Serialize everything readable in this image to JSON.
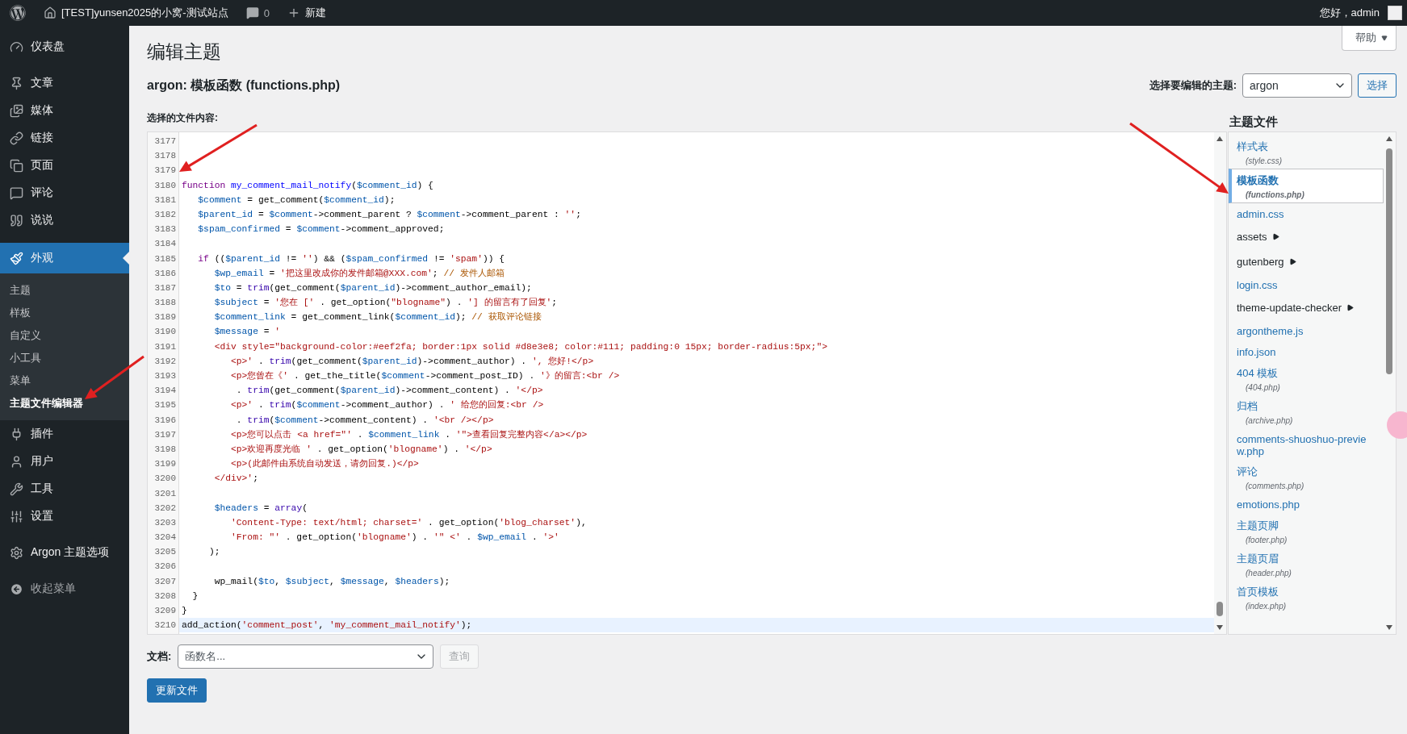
{
  "admin_bar": {
    "site_title": "[TEST]yunsen2025的小窝-测试站点",
    "comments": "0",
    "new": "新建",
    "greeting": "您好，admin"
  },
  "menu_groups": [
    [
      {
        "label": "仪表盘",
        "selected": false
      }
    ],
    [
      {
        "label": "文章",
        "selected": false
      },
      {
        "label": "媒体",
        "selected": false
      },
      {
        "label": "链接",
        "selected": false
      },
      {
        "label": "页面",
        "selected": false
      },
      {
        "label": "评论",
        "selected": false
      },
      {
        "label": "说说",
        "selected": false
      }
    ],
    [
      {
        "label": "外观",
        "selected": true,
        "submenu": [
          {
            "label": "主题",
            "selected": false
          },
          {
            "label": "样板",
            "selected": false
          },
          {
            "label": "自定义",
            "selected": false
          },
          {
            "label": "小工具",
            "selected": false
          },
          {
            "label": "菜单",
            "selected": false
          },
          {
            "label": "主题文件编辑器",
            "selected": true
          }
        ]
      },
      {
        "label": "插件",
        "selected": false
      },
      {
        "label": "用户",
        "selected": false
      },
      {
        "label": "工具",
        "selected": false
      },
      {
        "label": "设置",
        "selected": false
      }
    ],
    [
      {
        "label": "Argon 主题选项",
        "selected": false
      }
    ]
  ],
  "collapse_menu": "收起菜单",
  "help": "帮助",
  "title": "编辑主题",
  "file_heading": "argon: 模板函数 (functions.php)",
  "theme_picker": {
    "label": "选择要编辑的主题:",
    "value": "argon",
    "button": "选择"
  },
  "content_label": "选择的文件内容:",
  "code_lines": [
    {
      "number": "3177",
      "active": false
    },
    {
      "number": "3178",
      "active": false
    },
    {
      "number": "3179",
      "active": false
    },
    {
      "number": "3180",
      "active": false,
      "tokens": [
        {
          "kind": "keyword",
          "text": "function"
        },
        {
          "kind": "def",
          "text": " my_comment_mail_notify"
        },
        {
          "kind": "plain",
          "text": "("
        },
        {
          "kind": "var",
          "text": "$comment_id"
        },
        {
          "kind": "plain",
          "text": ") {"
        }
      ]
    },
    {
      "number": "3181",
      "active": false,
      "tokens": [
        {
          "kind": "var",
          "text": "   $comment"
        },
        {
          "kind": "plain",
          "text": " = get_comment("
        },
        {
          "kind": "var",
          "text": "$comment_id"
        },
        {
          "kind": "plain",
          "text": ");"
        }
      ]
    },
    {
      "number": "3182",
      "active": false,
      "tokens": [
        {
          "kind": "var",
          "text": "   $parent_id"
        },
        {
          "kind": "plain",
          "text": " = "
        },
        {
          "kind": "var",
          "text": "$comment"
        },
        {
          "kind": "plain",
          "text": "->comment_parent ? "
        },
        {
          "kind": "var",
          "text": "$comment"
        },
        {
          "kind": "plain",
          "text": "->comment_parent : "
        },
        {
          "kind": "string",
          "text": "''"
        },
        {
          "kind": "plain",
          "text": ";"
        }
      ]
    },
    {
      "number": "3183",
      "active": false,
      "tokens": [
        {
          "kind": "var",
          "text": "   $spam_confirmed"
        },
        {
          "kind": "plain",
          "text": " = "
        },
        {
          "kind": "var",
          "text": "$comment"
        },
        {
          "kind": "plain",
          "text": "->comment_approved;"
        }
      ]
    },
    {
      "number": "3184",
      "active": false
    },
    {
      "number": "3185",
      "active": false,
      "tokens": [
        {
          "kind": "keyword",
          "text": "   if"
        },
        {
          "kind": "plain",
          "text": " (("
        },
        {
          "kind": "var",
          "text": "$parent_id"
        },
        {
          "kind": "plain",
          "text": " != "
        },
        {
          "kind": "string",
          "text": "''"
        },
        {
          "kind": "plain",
          "text": ") && ("
        },
        {
          "kind": "var",
          "text": "$spam_confirmed"
        },
        {
          "kind": "plain",
          "text": " != "
        },
        {
          "kind": "string",
          "text": "'spam'"
        },
        {
          "kind": "plain",
          "text": ")) {"
        }
      ]
    },
    {
      "number": "3186",
      "active": false,
      "tokens": [
        {
          "kind": "var",
          "text": "      $wp_email"
        },
        {
          "kind": "plain",
          "text": " = "
        },
        {
          "kind": "string",
          "text": "'把这里改成你的发件邮箱@XXX.com'"
        },
        {
          "kind": "plain",
          "text": "; "
        },
        {
          "kind": "comment",
          "text": "// 发件人邮箱"
        }
      ]
    },
    {
      "number": "3187",
      "active": false,
      "tokens": [
        {
          "kind": "var",
          "text": "      $to"
        },
        {
          "kind": "plain",
          "text": " = "
        },
        {
          "kind": "builtin",
          "text": "trim"
        },
        {
          "kind": "plain",
          "text": "(get_comment("
        },
        {
          "kind": "var",
          "text": "$parent_id"
        },
        {
          "kind": "plain",
          "text": ")->comment_author_email);"
        }
      ]
    },
    {
      "number": "3188",
      "active": false,
      "tokens": [
        {
          "kind": "var",
          "text": "      $subject"
        },
        {
          "kind": "plain",
          "text": " = "
        },
        {
          "kind": "string",
          "text": "'您在 ['"
        },
        {
          "kind": "plain",
          "text": " . get_option("
        },
        {
          "kind": "string",
          "text": "\"blogname\""
        },
        {
          "kind": "plain",
          "text": ") . "
        },
        {
          "kind": "string",
          "text": "'] 的留言有了回复'"
        },
        {
          "kind": "plain",
          "text": ";"
        }
      ]
    },
    {
      "number": "3189",
      "active": false,
      "tokens": [
        {
          "kind": "var",
          "text": "      $comment_link"
        },
        {
          "kind": "plain",
          "text": " = get_comment_link("
        },
        {
          "kind": "var",
          "text": "$comment_id"
        },
        {
          "kind": "plain",
          "text": "); "
        },
        {
          "kind": "comment",
          "text": "// 获取评论链接"
        }
      ]
    },
    {
      "number": "3190",
      "active": false,
      "tokens": [
        {
          "kind": "var",
          "text": "      $message"
        },
        {
          "kind": "plain",
          "text": " = "
        },
        {
          "kind": "string",
          "text": "'"
        }
      ]
    },
    {
      "number": "3191",
      "active": false,
      "tokens": [
        {
          "kind": "string",
          "text": "      <div style=\"background-color:#eef2fa; border:1px solid #d8e3e8; color:#111; padding:0 15px; border-radius:5px;\">"
        }
      ]
    },
    {
      "number": "3192",
      "active": false,
      "tokens": [
        {
          "kind": "string",
          "text": "         <p>'"
        },
        {
          "kind": "plain",
          "text": " . "
        },
        {
          "kind": "builtin",
          "text": "trim"
        },
        {
          "kind": "plain",
          "text": "(get_comment("
        },
        {
          "kind": "var",
          "text": "$parent_id"
        },
        {
          "kind": "plain",
          "text": ")->comment_author) . "
        },
        {
          "kind": "string",
          "text": "', 您好!</p>"
        }
      ]
    },
    {
      "number": "3193",
      "active": false,
      "tokens": [
        {
          "kind": "string",
          "text": "         <p>您曾在《'"
        },
        {
          "kind": "plain",
          "text": " . get_the_title("
        },
        {
          "kind": "var",
          "text": "$comment"
        },
        {
          "kind": "plain",
          "text": "->comment_post_ID) . "
        },
        {
          "kind": "string",
          "text": "'》的留言:<br />"
        }
      ]
    },
    {
      "number": "3194",
      "active": false,
      "tokens": [
        {
          "kind": "plain",
          "text": "          . "
        },
        {
          "kind": "builtin",
          "text": "trim"
        },
        {
          "kind": "plain",
          "text": "(get_comment("
        },
        {
          "kind": "var",
          "text": "$parent_id"
        },
        {
          "kind": "plain",
          "text": ")->comment_content) . "
        },
        {
          "kind": "string",
          "text": "'</p>"
        }
      ]
    },
    {
      "number": "3195",
      "active": false,
      "tokens": [
        {
          "kind": "string",
          "text": "         <p>'"
        },
        {
          "kind": "plain",
          "text": " . "
        },
        {
          "kind": "builtin",
          "text": "trim"
        },
        {
          "kind": "plain",
          "text": "("
        },
        {
          "kind": "var",
          "text": "$comment"
        },
        {
          "kind": "plain",
          "text": "->comment_author) . "
        },
        {
          "kind": "string",
          "text": "' 给您的回复:<br />"
        }
      ]
    },
    {
      "number": "3196",
      "active": false,
      "tokens": [
        {
          "kind": "plain",
          "text": "          . "
        },
        {
          "kind": "builtin",
          "text": "trim"
        },
        {
          "kind": "plain",
          "text": "("
        },
        {
          "kind": "var",
          "text": "$comment"
        },
        {
          "kind": "plain",
          "text": "->comment_content) . "
        },
        {
          "kind": "string",
          "text": "'<br /></p>"
        }
      ]
    },
    {
      "number": "3197",
      "active": false,
      "tokens": [
        {
          "kind": "string",
          "text": "         <p>您可以点击 <a href=\"'"
        },
        {
          "kind": "plain",
          "text": " . "
        },
        {
          "kind": "var",
          "text": "$comment_link"
        },
        {
          "kind": "plain",
          "text": " . "
        },
        {
          "kind": "string",
          "text": "'\">查看回复完整内容</a></p>"
        }
      ]
    },
    {
      "number": "3198",
      "active": false,
      "tokens": [
        {
          "kind": "string",
          "text": "         <p>欢迎再度光临 '"
        },
        {
          "kind": "plain",
          "text": " . get_option("
        },
        {
          "kind": "string",
          "text": "'blogname'"
        },
        {
          "kind": "plain",
          "text": ") . "
        },
        {
          "kind": "string",
          "text": "'</p>"
        }
      ]
    },
    {
      "number": "3199",
      "active": false,
      "tokens": [
        {
          "kind": "string",
          "text": "         <p>(此邮件由系统自动发送，请勿回复.)</p>"
        }
      ]
    },
    {
      "number": "3200",
      "active": false,
      "tokens": [
        {
          "kind": "string",
          "text": "      </div>'"
        },
        {
          "kind": "plain",
          "text": ";"
        }
      ]
    },
    {
      "number": "3201",
      "active": false
    },
    {
      "number": "3202",
      "active": false,
      "tokens": [
        {
          "kind": "var",
          "text": "      $headers"
        },
        {
          "kind": "plain",
          "text": " = "
        },
        {
          "kind": "builtin",
          "text": "array"
        },
        {
          "kind": "plain",
          "text": "("
        }
      ]
    },
    {
      "number": "3203",
      "active": false,
      "tokens": [
        {
          "kind": "string",
          "text": "         'Content-Type: text/html; charset='"
        },
        {
          "kind": "plain",
          "text": " . get_option("
        },
        {
          "kind": "string",
          "text": "'blog_charset'"
        },
        {
          "kind": "plain",
          "text": "),"
        }
      ]
    },
    {
      "number": "3204",
      "active": false,
      "tokens": [
        {
          "kind": "string",
          "text": "         'From: \"'"
        },
        {
          "kind": "plain",
          "text": " . get_option("
        },
        {
          "kind": "string",
          "text": "'blogname'"
        },
        {
          "kind": "plain",
          "text": ") . "
        },
        {
          "kind": "string",
          "text": "'\" <'"
        },
        {
          "kind": "plain",
          "text": " . "
        },
        {
          "kind": "var",
          "text": "$wp_email"
        },
        {
          "kind": "plain",
          "text": " . "
        },
        {
          "kind": "string",
          "text": "'>'"
        }
      ]
    },
    {
      "number": "3205",
      "active": false,
      "tokens": [
        {
          "kind": "plain",
          "text": "     );"
        }
      ]
    },
    {
      "number": "3206",
      "active": false
    },
    {
      "number": "3207",
      "active": false,
      "tokens": [
        {
          "kind": "plain",
          "text": "      wp_mail("
        },
        {
          "kind": "var",
          "text": "$to"
        },
        {
          "kind": "plain",
          "text": ", "
        },
        {
          "kind": "var",
          "text": "$subject"
        },
        {
          "kind": "plain",
          "text": ", "
        },
        {
          "kind": "var",
          "text": "$message"
        },
        {
          "kind": "plain",
          "text": ", "
        },
        {
          "kind": "var",
          "text": "$headers"
        },
        {
          "kind": "plain",
          "text": ");"
        }
      ]
    },
    {
      "number": "3208",
      "active": false,
      "tokens": [
        {
          "kind": "plain",
          "text": "  }"
        }
      ]
    },
    {
      "number": "3209",
      "active": false,
      "tokens": [
        {
          "kind": "plain",
          "text": "}"
        }
      ]
    },
    {
      "number": "3210",
      "active": true,
      "tokens": [
        {
          "kind": "plain",
          "text": "add_action("
        },
        {
          "kind": "string",
          "text": "'comment_post'"
        },
        {
          "kind": "plain",
          "text": ", "
        },
        {
          "kind": "string",
          "text": "'my_comment_mail_notify'"
        },
        {
          "kind": "plain",
          "text": ");"
        }
      ]
    }
  ],
  "theme_files": {
    "heading": "主题文件",
    "items": [
      {
        "kind": "file",
        "label": "样式表",
        "file": "(style.css)",
        "selected": false
      },
      {
        "kind": "file",
        "label": "模板函数",
        "file": "(functions.php)",
        "selected": true
      },
      {
        "kind": "file",
        "label": "admin.css",
        "selected": false
      },
      {
        "kind": "folder",
        "label": "assets",
        "selected": false
      },
      {
        "kind": "folder",
        "label": "gutenberg",
        "selected": false
      },
      {
        "kind": "file",
        "label": "login.css",
        "selected": false
      },
      {
        "kind": "folder",
        "label": "theme-update-checker",
        "selected": false
      },
      {
        "kind": "file",
        "label": "argontheme.js",
        "selected": false
      },
      {
        "kind": "file",
        "label": "info.json",
        "selected": false
      },
      {
        "kind": "file",
        "label": "404 模板",
        "file": "(404.php)",
        "selected": false
      },
      {
        "kind": "file",
        "label": "归档",
        "file": "(archive.php)",
        "selected": false
      },
      {
        "kind": "file",
        "label": "comments-shuoshuo-preview.php",
        "selected": false
      },
      {
        "kind": "file",
        "label": "评论",
        "file": "(comments.php)",
        "selected": false
      },
      {
        "kind": "file",
        "label": "emotions.php",
        "selected": false
      },
      {
        "kind": "file",
        "label": "主题页脚",
        "file": "(footer.php)",
        "selected": false
      },
      {
        "kind": "file",
        "label": "主题页眉",
        "file": "(header.php)",
        "selected": false
      },
      {
        "kind": "file",
        "label": "首页模板",
        "file": "(index.php)",
        "selected": false
      }
    ]
  },
  "docs": {
    "label": "文档:",
    "placeholder": "函数名...",
    "button": "查询",
    "button_disabled": true
  },
  "update_button": "更新文件"
}
